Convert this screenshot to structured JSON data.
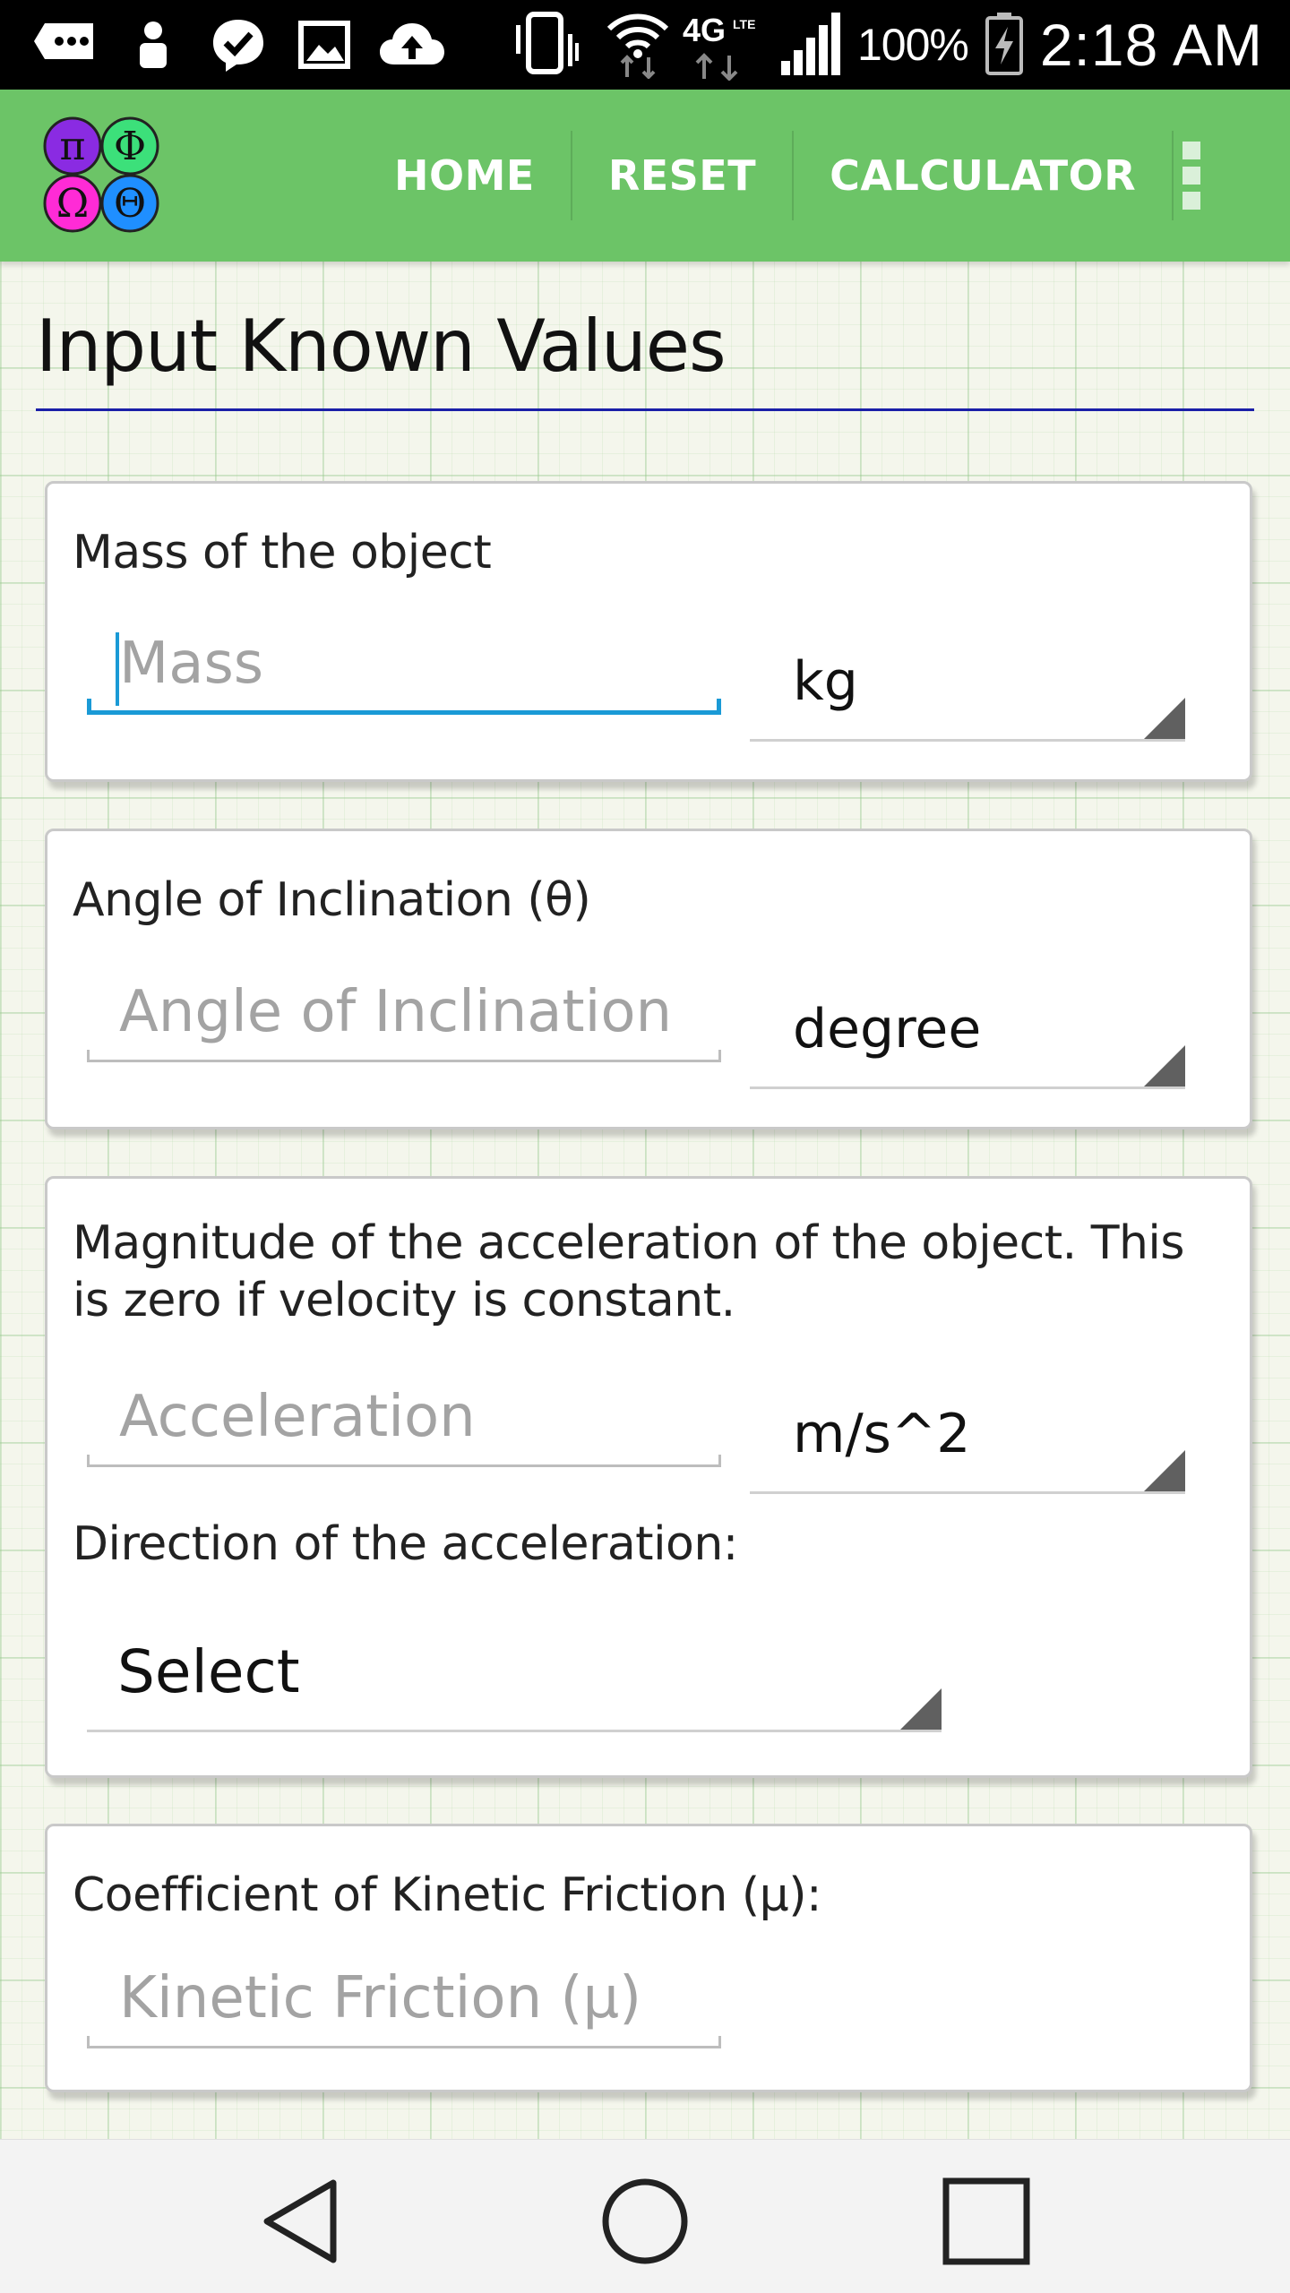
{
  "status_bar": {
    "battery_percent": "100%",
    "time": "2:18 AM",
    "network_label": "4G LTE",
    "icons": [
      "chat-icon",
      "person-icon",
      "checkmark-icon",
      "image-icon",
      "cloud-upload-icon",
      "vibrate-icon",
      "wifi-icon",
      "lte-icon",
      "signal-icon",
      "battery-charging-icon"
    ]
  },
  "app_bar": {
    "logo_symbols": [
      "π",
      "Φ",
      "Ω",
      "Θ"
    ],
    "nav": [
      {
        "label": "HOME"
      },
      {
        "label": "RESET"
      },
      {
        "label": "CALCULATOR"
      }
    ],
    "menu_icon": "overflow-menu-icon"
  },
  "page": {
    "title": "Input Known Values"
  },
  "cards": {
    "mass": {
      "label": "Mass of the object",
      "placeholder": "Mass",
      "unit": "kg"
    },
    "angle": {
      "label": "Angle of Inclination (θ)",
      "placeholder": "Angle of Inclination",
      "unit": "degree"
    },
    "acceleration": {
      "label": "Magnitude of the acceleration of the object. This is zero if velocity is constant.",
      "placeholder": "Acceleration",
      "unit": "m/s^2",
      "direction_label": "Direction of the acceleration:",
      "direction_value": "Select"
    },
    "friction": {
      "label": "Coefficient of Kinetic Friction (μ):",
      "placeholder": "Kinetic Friction (μ)"
    }
  },
  "system_nav": [
    "back-icon",
    "home-circle-icon",
    "recents-icon"
  ],
  "colors": {
    "app_bar": "#6cc467",
    "focus": "#1a9ad6",
    "title_rule": "#1a1fa8"
  }
}
